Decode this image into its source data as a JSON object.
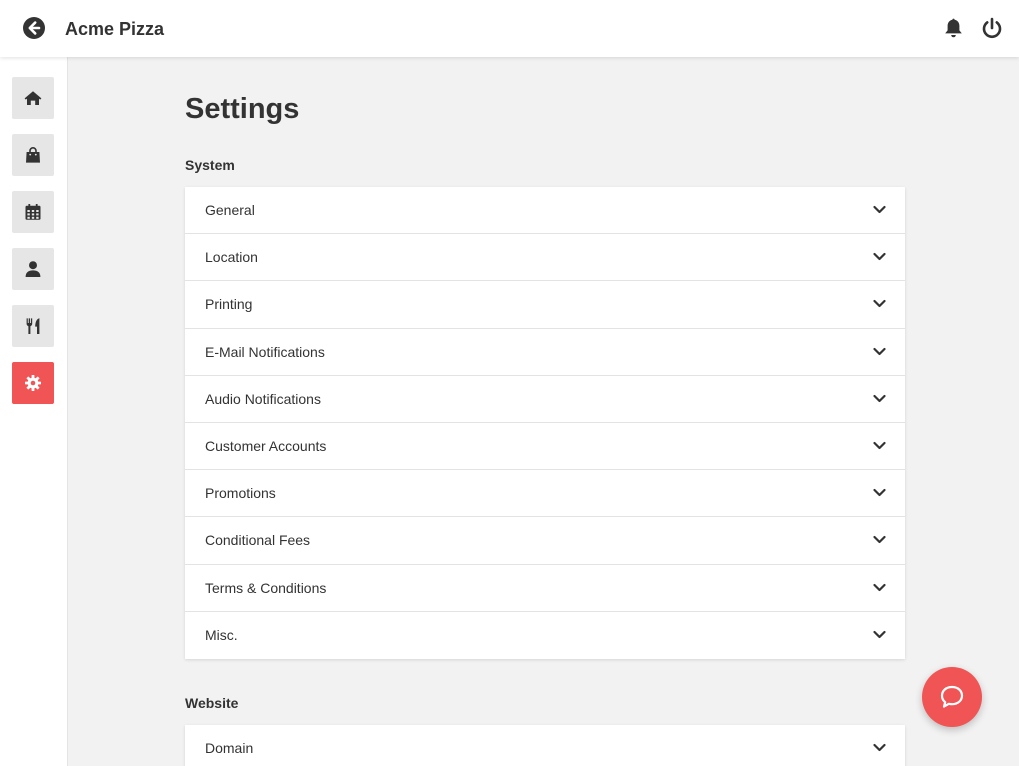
{
  "header": {
    "title": "Acme Pizza",
    "back_icon": "arrow-circle-left-icon",
    "notifications_icon": "bell-icon",
    "logout_icon": "power-icon"
  },
  "sidebar": {
    "items": [
      {
        "name": "home",
        "icon": "home-icon",
        "active": false
      },
      {
        "name": "orders",
        "icon": "shopping-bag-icon",
        "active": false
      },
      {
        "name": "calendar",
        "icon": "calendar-icon",
        "active": false
      },
      {
        "name": "customers",
        "icon": "user-icon",
        "active": false
      },
      {
        "name": "menu",
        "icon": "utensils-icon",
        "active": false
      },
      {
        "name": "settings",
        "icon": "gear-icon",
        "active": true
      }
    ]
  },
  "page": {
    "title": "Settings",
    "sections": [
      {
        "label": "System",
        "items": [
          "General",
          "Location",
          "Printing",
          "E-Mail Notifications",
          "Audio Notifications",
          "Customer Accounts",
          "Promotions",
          "Conditional Fees",
          "Terms & Conditions",
          "Misc."
        ]
      },
      {
        "label": "Website",
        "items": [
          "Domain"
        ]
      }
    ]
  },
  "help_button": {
    "icon": "chat-bubble-icon"
  },
  "colors": {
    "accent": "#f05454",
    "background": "#f2f2f2",
    "text": "#333333",
    "nav_inactive": "#e6e6e6"
  }
}
